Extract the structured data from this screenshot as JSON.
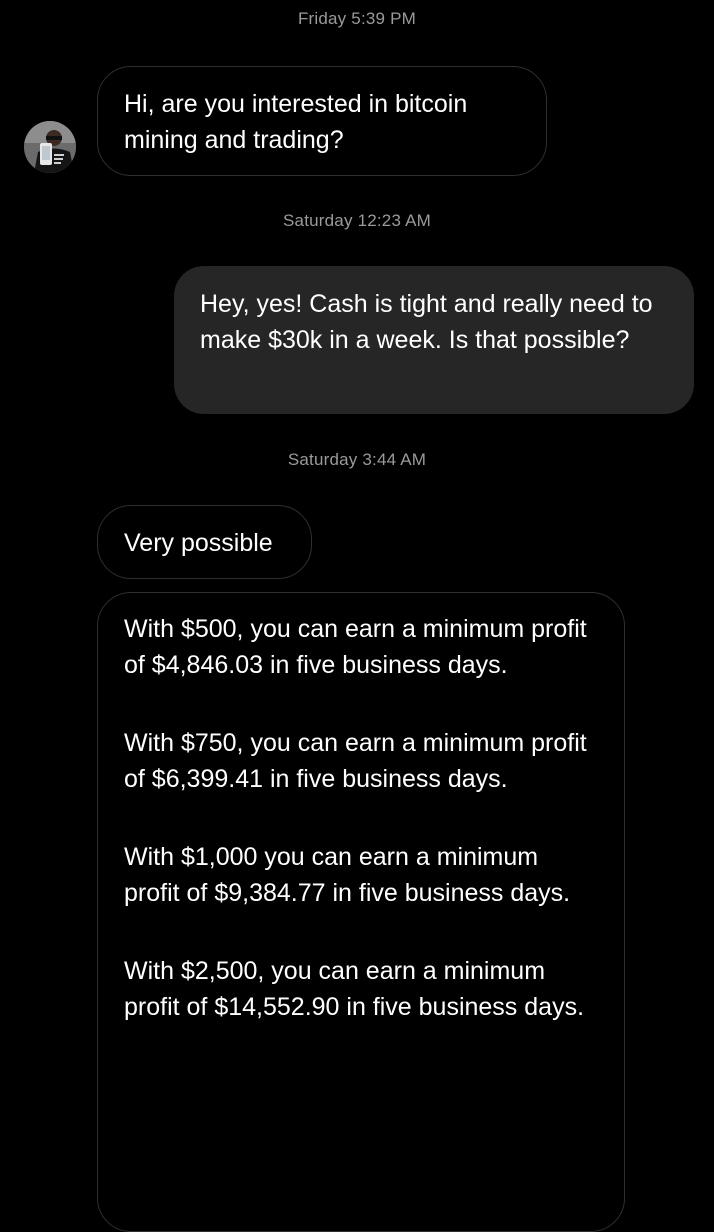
{
  "conversation": {
    "timestamps": [
      "Friday 5:39 PM",
      "Saturday 12:23 AM",
      "Saturday 3:44 AM"
    ],
    "contact": {
      "avatar_icon": "profile-photo-person-holding-phone"
    },
    "messages": [
      {
        "direction": "incoming",
        "text": "Hi, are you interested in bitcoin mining and trading?"
      },
      {
        "direction": "outgoing",
        "text": "Hey, yes! Cash is tight and really need to make $30k in a week. Is that possible?"
      },
      {
        "direction": "incoming",
        "text": "Very possible"
      },
      {
        "direction": "incoming",
        "paragraphs": [
          "With $500, you can earn a minimum profit of $4,846.03 in five business days.",
          "With $750, you can earn a minimum profit of $6,399.41 in five business days.",
          "With $1,000 you can earn a minimum profit of $9,384.77 in five business days.",
          "With $2,500, you can earn a minimum profit of $14,552.90 in five business days."
        ]
      }
    ]
  },
  "colors": {
    "background": "#000000",
    "incoming_border": "#2f2f2f",
    "outgoing_bubble": "#262626",
    "timestamp_text": "#9a9a9a",
    "message_text": "#ffffff"
  }
}
